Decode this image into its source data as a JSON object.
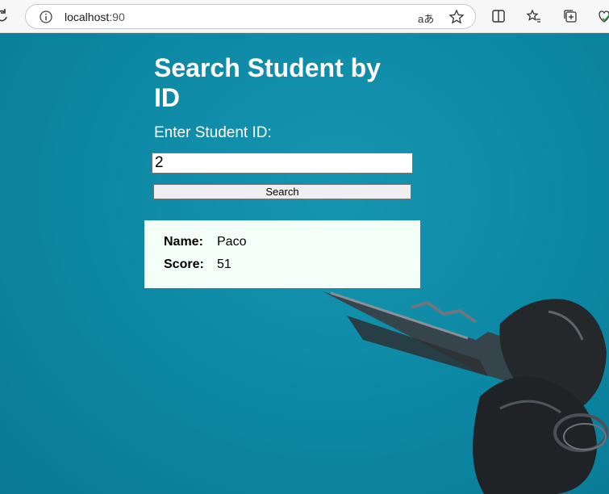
{
  "browser": {
    "url_host": "localhost",
    "url_port": ":90",
    "read_aloud_label": "aあ"
  },
  "page": {
    "title": "Search Student by ID",
    "id_label": "Enter Student ID:",
    "id_value": "2",
    "search_label": "Search"
  },
  "result": {
    "name_label": "Name:",
    "name_value": "Paco",
    "score_label": "Score:",
    "score_value": "51"
  },
  "colors": {
    "background": "#0c87a3",
    "result_card": "#f3fff8",
    "title_text": "#ffffff"
  }
}
